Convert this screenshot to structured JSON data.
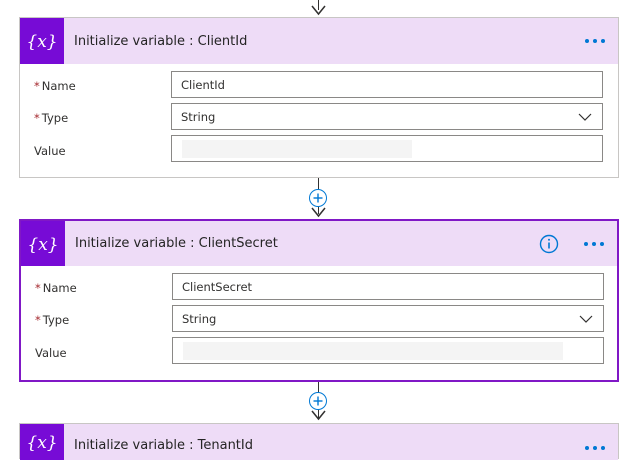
{
  "steps": [
    {
      "title": "Initialize variable : ClientId",
      "fields": {
        "name_label": "Name",
        "name_value": "ClientId",
        "type_label": "Type",
        "type_value": "String",
        "value_label": "Value"
      }
    },
    {
      "title": "Initialize variable : ClientSecret",
      "fields": {
        "name_label": "Name",
        "name_value": "ClientSecret",
        "type_label": "Type",
        "type_value": "String",
        "value_label": "Value"
      }
    },
    {
      "title": "Initialize variable : TenantId"
    }
  ],
  "icons": {
    "variable": "variable-icon",
    "more": "more-options-icon",
    "info": "info-icon",
    "add": "add-step-icon",
    "chevron": "chevron-down-icon"
  },
  "colors": {
    "icon_bg": "#770bd6",
    "header_bg": "#eedcf7",
    "selected_border": "#8018c6",
    "accent": "#0078d4",
    "required": "#a4262c"
  }
}
